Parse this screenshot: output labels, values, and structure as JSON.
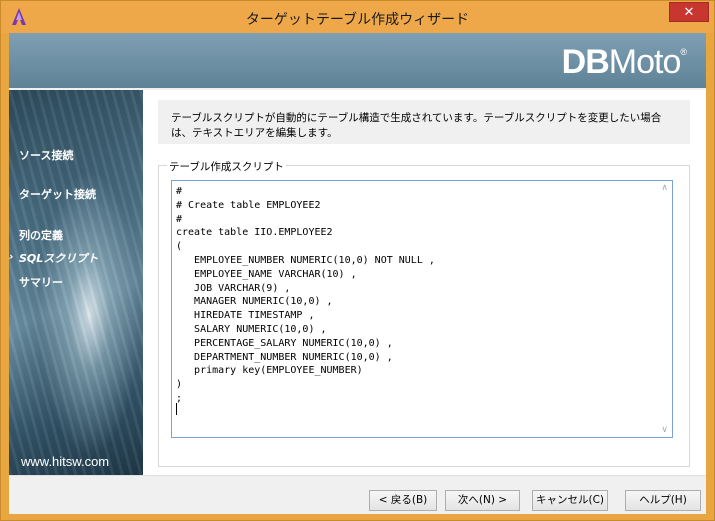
{
  "window": {
    "title": "ターゲットテーブル作成ウィザード",
    "close_symbol": "✕"
  },
  "header": {
    "logo_bold": "DB",
    "logo_rest": "Moto",
    "logo_mark": "®"
  },
  "sidebar": {
    "items": [
      {
        "label": "ソース接続",
        "active": false
      },
      {
        "label": "ターゲット接続",
        "active": false
      },
      {
        "label": "列の定義",
        "active": false
      },
      {
        "label": "SQLスクリプト",
        "active": true
      },
      {
        "label": "サマリー",
        "active": false
      }
    ],
    "active_marker": "›",
    "footer_url": "www.hitsw.com"
  },
  "content": {
    "description": "テーブルスクリプトが自動的にテーブル構造で生成されています。テーブルスクリプトを変更したい場合は、テキストエリアを編集します。",
    "group_label": "テーブル作成スクリプト",
    "script": "#\n# Create table EMPLOYEE2\n#\ncreate table IIO.EMPLOYEE2\n(\n   EMPLOYEE_NUMBER NUMERIC(10,0) NOT NULL ,\n   EMPLOYEE_NAME VARCHAR(10) ,\n   JOB VARCHAR(9) ,\n   MANAGER NUMERIC(10,0) ,\n   HIREDATE TIMESTAMP ,\n   SALARY NUMERIC(10,0) ,\n   PERCENTAGE_SALARY NUMERIC(10,0) ,\n   DEPARTMENT_NUMBER NUMERIC(10,0) ,\n   primary key(EMPLOYEE_NUMBER)\n)\n;",
    "scroll_up": "∧",
    "scroll_down": "∨"
  },
  "buttons": {
    "back": "< 戻る(B)",
    "next": "次へ(N) >",
    "cancel": "キャンセル(C)",
    "help": "ヘルプ(H)"
  },
  "colors": {
    "titlebar": "#eea84a",
    "close": "#c7372f",
    "header": "#6b8ea2",
    "editor_border": "#7aa2d8"
  }
}
